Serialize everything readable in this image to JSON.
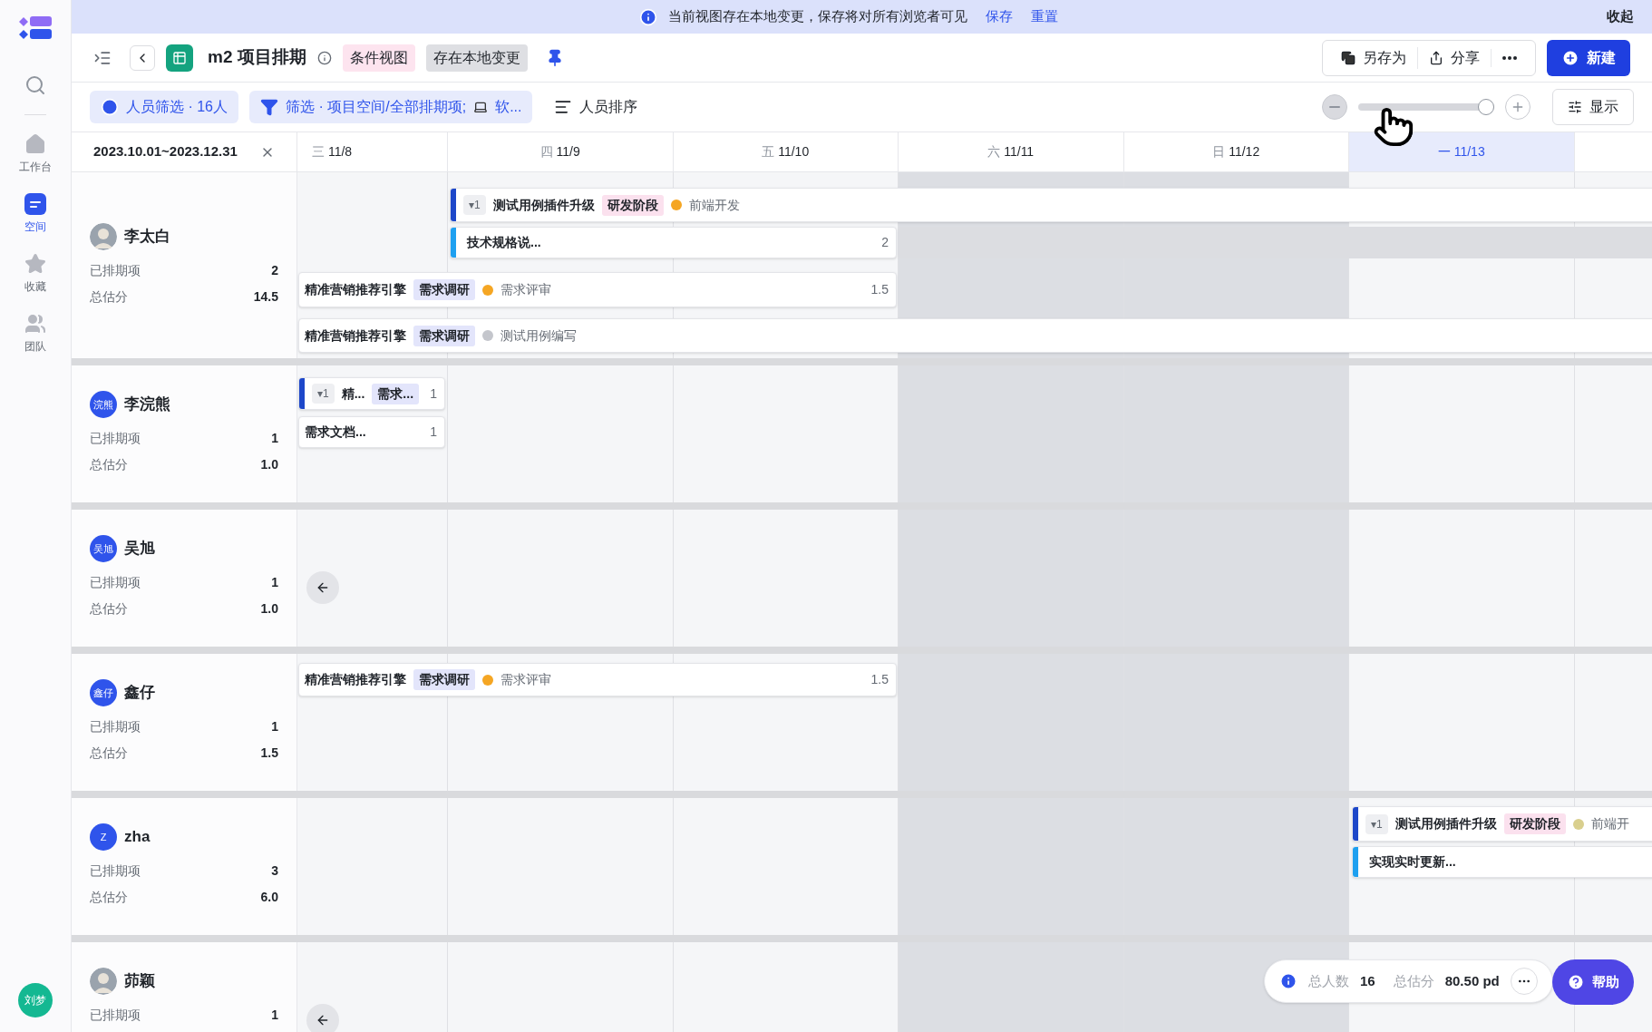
{
  "sidebar": {
    "items": [
      {
        "label": "工作台",
        "selected": false
      },
      {
        "label": "空间",
        "selected": true
      },
      {
        "label": "收藏",
        "selected": false
      },
      {
        "label": "团队",
        "selected": false
      }
    ],
    "user": {
      "initials": "刘梦"
    }
  },
  "banner": {
    "message": "当前视图存在本地变更，保存将对所有浏览者可见",
    "links": [
      "保存",
      "重置"
    ],
    "collapse": "收起"
  },
  "header": {
    "title": "m2 项目排期",
    "tags": [
      {
        "label": "条件视图",
        "color": "#fde4ef"
      },
      {
        "label": "存在本地变更",
        "color": "#dedfe3"
      }
    ],
    "actions": [
      "另存为",
      "分享"
    ],
    "primary": "新建"
  },
  "filters": {
    "people": "人员筛选 · 16人",
    "filter": "筛选 · 项目空间/全部排期项;",
    "filter_tail": "软...",
    "sort": "人员排序",
    "zoom": {
      "level": 1
    },
    "display": "显示"
  },
  "timeline": {
    "range": "2023.10.01~2023.12.31",
    "days": [
      {
        "weekday": "三",
        "date": "11/8",
        "weekend": false,
        "today": false
      },
      {
        "weekday": "四",
        "date": "11/9",
        "weekend": false,
        "today": false
      },
      {
        "weekday": "五",
        "date": "11/10",
        "weekend": false,
        "today": false
      },
      {
        "weekday": "六",
        "date": "11/11",
        "weekend": true,
        "today": false
      },
      {
        "weekday": "日",
        "date": "11/12",
        "weekend": true,
        "today": false
      },
      {
        "weekday": "一",
        "date": "11/13",
        "weekend": false,
        "today": true
      }
    ]
  },
  "people": [
    {
      "name": "李太白",
      "avatar": {
        "kind": "photo"
      },
      "scheduled_label": "已排期项",
      "scheduled": "2",
      "estimate_label": "总估分",
      "estimate": "14.5",
      "bars": [
        {
          "kind": "parent",
          "toggle": "▾1",
          "title": "测试用例插件升级",
          "tag": {
            "label": "研发阶段",
            "color": "#fbe1ee"
          },
          "status": {
            "label": "前端开发",
            "color": "#f5a623"
          }
        },
        {
          "kind": "child",
          "title": "技术规格说...",
          "estimate": "2"
        },
        {
          "kind": "task",
          "title": "精准营销推荐引擎",
          "tag": {
            "label": "需求调研",
            "color": "#e3e5fb"
          },
          "status": {
            "label": "需求评审",
            "color": "#f5a623"
          },
          "estimate": "1.5"
        },
        {
          "kind": "task",
          "title": "精准营销推荐引擎",
          "tag": {
            "label": "需求调研",
            "color": "#e3e5fb"
          },
          "status": {
            "label": "测试用例编写",
            "color": "#c4c6cc"
          }
        }
      ]
    },
    {
      "name": "李浣熊",
      "avatar": {
        "kind": "initials",
        "text": "浣熊"
      },
      "scheduled_label": "已排期项",
      "scheduled": "1",
      "estimate_label": "总估分",
      "estimate": "1.0",
      "bars": [
        {
          "kind": "parent",
          "toggle": "▾1",
          "title": "精...",
          "tag": {
            "label": "需求...",
            "color": "#e3e5fb"
          },
          "estimate": "1"
        },
        {
          "kind": "plain",
          "title": "需求文档...",
          "estimate": "1"
        }
      ]
    },
    {
      "name": "吴旭",
      "avatar": {
        "kind": "initials",
        "text": "吴旭"
      },
      "scheduled_label": "已排期项",
      "scheduled": "1",
      "estimate_label": "总估分",
      "estimate": "1.0",
      "earlier": true
    },
    {
      "name": "鑫仔",
      "avatar": {
        "kind": "initials",
        "text": "鑫仔"
      },
      "scheduled_label": "已排期项",
      "scheduled": "1",
      "estimate_label": "总估分",
      "estimate": "1.5",
      "bars": [
        {
          "kind": "task",
          "title": "精准营销推荐引擎",
          "tag": {
            "label": "需求调研",
            "color": "#e3e5fb"
          },
          "status": {
            "label": "需求评审",
            "color": "#f5a623"
          },
          "estimate": "1.5"
        }
      ]
    },
    {
      "name": "zha",
      "avatar": {
        "kind": "initials",
        "text": "Z"
      },
      "scheduled_label": "已排期项",
      "scheduled": "3",
      "estimate_label": "总估分",
      "estimate": "6.0",
      "bars": [
        {
          "kind": "parent",
          "toggle": "▾1",
          "title": "测试用例插件升级",
          "tag": {
            "label": "研发阶段",
            "color": "#fbe1ee"
          },
          "status": {
            "label": "前端开",
            "color": "#d9cf8e"
          }
        },
        {
          "kind": "child",
          "title": "实现实时更新..."
        }
      ]
    },
    {
      "name": "茆颖",
      "avatar": {
        "kind": "photo"
      },
      "scheduled_label": "已排期项",
      "scheduled": "1",
      "earlier": true
    }
  ],
  "summary": {
    "people_label": "总人数",
    "people": "16",
    "estimate_label": "总估分",
    "estimate": "80.50 pd"
  },
  "help": "帮助"
}
